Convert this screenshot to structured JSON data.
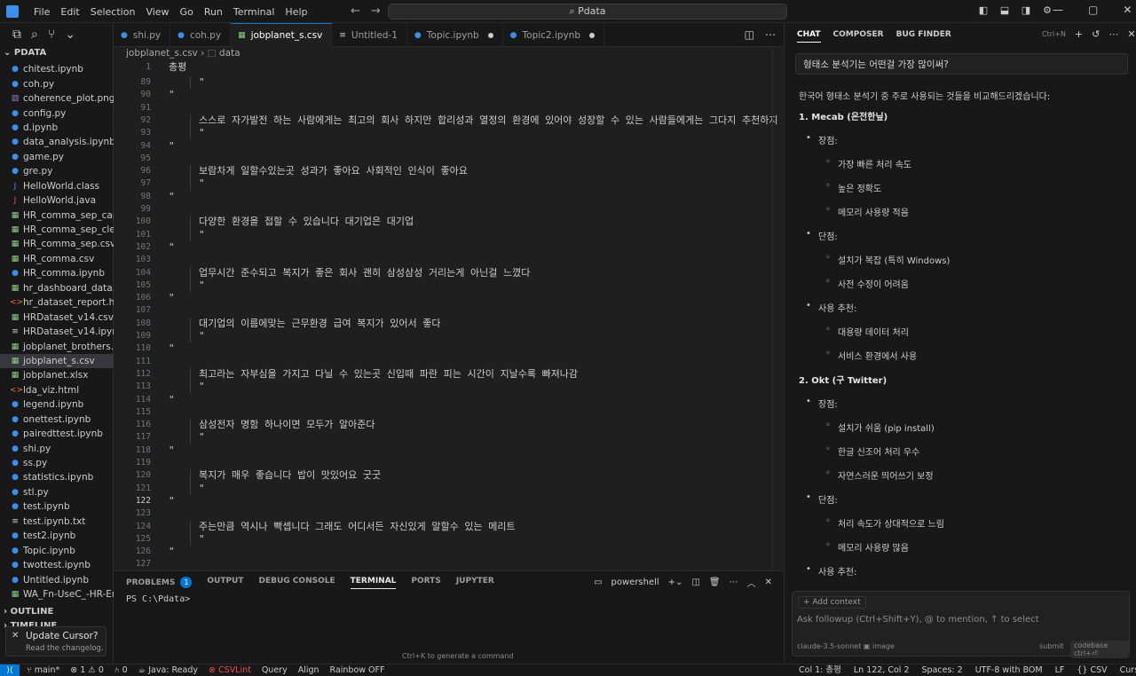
{
  "titlebar": {
    "menu": [
      "File",
      "Edit",
      "Selection",
      "View",
      "Go",
      "Run",
      "Terminal",
      "Help"
    ],
    "search": "Pdata"
  },
  "explorer": {
    "root": "PDATA",
    "files": [
      {
        "name": "chitest.ipynb",
        "type": "nb"
      },
      {
        "name": "coh.py",
        "type": "py"
      },
      {
        "name": "coherence_plot.png",
        "type": "img"
      },
      {
        "name": "config.py",
        "type": "py"
      },
      {
        "name": "d.ipynb",
        "type": "nb"
      },
      {
        "name": "data_analysis.ipynb",
        "type": "nb"
      },
      {
        "name": "game.py",
        "type": "py"
      },
      {
        "name": "gre.py",
        "type": "py"
      },
      {
        "name": "HelloWorld.class",
        "type": "class"
      },
      {
        "name": "HelloWorld.java",
        "type": "java"
      },
      {
        "name": "HR_comma_sep_capp...",
        "type": "csv"
      },
      {
        "name": "HR_comma_sep_clean...",
        "type": "csv"
      },
      {
        "name": "HR_comma_sep.csv",
        "type": "csv"
      },
      {
        "name": "HR_comma.csv",
        "type": "csv"
      },
      {
        "name": "HR_comma.ipynb",
        "type": "nb"
      },
      {
        "name": "hr_dashboard_data.csv",
        "type": "csv"
      },
      {
        "name": "hr_dataset_report.html",
        "type": "html"
      },
      {
        "name": "HRDataset_v14.csv",
        "type": "csv"
      },
      {
        "name": "HRDataset_v14.ipynb....",
        "type": "txt"
      },
      {
        "name": "jobplanet_brothers.xlsx",
        "type": "xlsx"
      },
      {
        "name": "jobplanet_s.csv",
        "type": "csv",
        "active": true
      },
      {
        "name": "jobplanet.xlsx",
        "type": "xlsx"
      },
      {
        "name": "lda_viz.html",
        "type": "html"
      },
      {
        "name": "legend.ipynb",
        "type": "nb"
      },
      {
        "name": "onettest.ipynb",
        "type": "nb"
      },
      {
        "name": "pairedttest.ipynb",
        "type": "nb"
      },
      {
        "name": "shi.py",
        "type": "py"
      },
      {
        "name": "ss.py",
        "type": "py"
      },
      {
        "name": "statistics.ipynb",
        "type": "nb"
      },
      {
        "name": "stl.py",
        "type": "py"
      },
      {
        "name": "test.ipynb",
        "type": "nb"
      },
      {
        "name": "test.ipynb.txt",
        "type": "txt"
      },
      {
        "name": "test2.ipynb",
        "type": "nb"
      },
      {
        "name": "Topic.ipynb",
        "type": "nb"
      },
      {
        "name": "twottest.ipynb",
        "type": "nb"
      },
      {
        "name": "Untitled.ipynb",
        "type": "nb"
      },
      {
        "name": "WA_Fn-UseC_-HR-Em...",
        "type": "xlsx"
      }
    ],
    "outline": "OUTLINE",
    "timeline": "TIMELINE"
  },
  "toast": {
    "title": "Update Cursor?",
    "sub": "Read the changelog."
  },
  "tabs": [
    {
      "label": "shi.py",
      "icon": "python-icon"
    },
    {
      "label": "coh.py",
      "icon": "python-icon"
    },
    {
      "label": "jobplanet_s.csv",
      "icon": "csv-icon",
      "active": true
    },
    {
      "label": "Untitled-1",
      "icon": "file-icon"
    },
    {
      "label": "Topic.ipynb",
      "icon": "notebook-icon",
      "dirty": true
    },
    {
      "label": "Topic2.ipynb",
      "icon": "notebook-icon",
      "dirty": true
    }
  ],
  "breadcrumb": {
    "file": "jobplanet_s.csv",
    "symbol": "data"
  },
  "editor": {
    "sticky": {
      "num": "1",
      "text": "총평"
    },
    "lines": [
      {
        "num": "89",
        "text": "\"",
        "indent": true
      },
      {
        "num": "90",
        "text": "\""
      },
      {
        "num": "91",
        "text": ""
      },
      {
        "num": "92",
        "text": "스스로 자가발전 하는 사람에게는 최고의 회사 하지만 합리성과 열정의 환경에 있어야 성장할 수 있는 사람들에게는 그다지 추천하지",
        "indent": true
      },
      {
        "num": "93",
        "text": "\"",
        "indent": true
      },
      {
        "num": "94",
        "text": "\""
      },
      {
        "num": "95",
        "text": ""
      },
      {
        "num": "96",
        "text": "보람차게 일할수있는곳 성과가 좋아요 사회적인 인식이 좋아요",
        "indent": true
      },
      {
        "num": "97",
        "text": "\"",
        "indent": true
      },
      {
        "num": "98",
        "text": "\""
      },
      {
        "num": "99",
        "text": ""
      },
      {
        "num": "100",
        "text": "다양한 환경을 접할 수 있습니다 대기업은 대기업",
        "indent": true
      },
      {
        "num": "101",
        "text": "\"",
        "indent": true
      },
      {
        "num": "102",
        "text": "\""
      },
      {
        "num": "103",
        "text": ""
      },
      {
        "num": "104",
        "text": "업무시간 준수되고 복지가 좋은 회사 괜히 삼성삼성 거리는게 아닌걸 느꼈다",
        "indent": true
      },
      {
        "num": "105",
        "text": "\"",
        "indent": true
      },
      {
        "num": "106",
        "text": "\""
      },
      {
        "num": "107",
        "text": ""
      },
      {
        "num": "108",
        "text": "대기업의 이름에맞는 근무환경 급여 복지가 있어서 좋다",
        "indent": true
      },
      {
        "num": "109",
        "text": "\"",
        "indent": true
      },
      {
        "num": "110",
        "text": "\""
      },
      {
        "num": "111",
        "text": ""
      },
      {
        "num": "112",
        "text": "최고라는 자부심을 가지고 다닐 수 있는곳 신입때 파란 피는 시간이 지날수록 빠져나감",
        "indent": true
      },
      {
        "num": "113",
        "text": "\"",
        "indent": true
      },
      {
        "num": "114",
        "text": "\""
      },
      {
        "num": "115",
        "text": ""
      },
      {
        "num": "116",
        "text": "삼성전자 명함 하나이면 모두가 알아준다",
        "indent": true
      },
      {
        "num": "117",
        "text": "\"",
        "indent": true
      },
      {
        "num": "118",
        "text": "\""
      },
      {
        "num": "119",
        "text": ""
      },
      {
        "num": "120",
        "text": "복지가 매우 좋습니다 밥이 맛있어요 굿굿",
        "indent": true
      },
      {
        "num": "121",
        "text": "\"",
        "indent": true
      },
      {
        "num": "122",
        "text": "\"",
        "current": true
      },
      {
        "num": "123",
        "text": ""
      },
      {
        "num": "124",
        "text": "주는만큼 역시나 빡셉니다 그래도 어디서든 자신있게 말할수 있는 메리트",
        "indent": true
      },
      {
        "num": "125",
        "text": "\"",
        "indent": true
      },
      {
        "num": "126",
        "text": "\""
      },
      {
        "num": "127",
        "text": ""
      }
    ]
  },
  "panel": {
    "tabs": [
      "PROBLEMS",
      "OUTPUT",
      "DEBUG CONSOLE",
      "TERMINAL",
      "PORTS",
      "JUPYTER"
    ],
    "problems_count": "1",
    "shell": "powershell",
    "prompt": "PS C:\\Pdata>",
    "hint": "Ctrl+K to generate a command"
  },
  "chat": {
    "tabs": [
      "CHAT",
      "COMPOSER",
      "BUG FINDER"
    ],
    "shortcut": "Ctrl+N",
    "question": "형태소 분석기는 어떤걸 가장 많이써?",
    "intro": "한국어 형태소 분석기 중 주로 사용되는 것들을 비교해드리겠습니다:",
    "items": [
      {
        "level": 0,
        "text": "1. Mecab (은전한닢)"
      },
      {
        "level": 1,
        "text": "장점:"
      },
      {
        "level": 2,
        "text": "가장 빠른 처리 속도"
      },
      {
        "level": 2,
        "text": "높은 정확도"
      },
      {
        "level": 2,
        "text": "메모리 사용량 적음"
      },
      {
        "level": 1,
        "text": "단점:"
      },
      {
        "level": 2,
        "text": "설치가 복잡 (특히 Windows)"
      },
      {
        "level": 2,
        "text": "사전 수정이 어려움"
      },
      {
        "level": 1,
        "text": "사용 추천:"
      },
      {
        "level": 2,
        "text": "대용량 데이터 처리"
      },
      {
        "level": 2,
        "text": "서비스 환경에서 사용"
      },
      {
        "level": 0,
        "text": "2. Okt (구 Twitter)"
      },
      {
        "level": 1,
        "text": "장점:"
      },
      {
        "level": 2,
        "text": "설치가 쉬움 (pip install)"
      },
      {
        "level": 2,
        "text": "한글 신조어 처리 우수"
      },
      {
        "level": 2,
        "text": "자연스러운 띄어쓰기 보정"
      },
      {
        "level": 1,
        "text": "단점:"
      },
      {
        "level": 2,
        "text": "처리 속도가 상대적으로 느림"
      },
      {
        "level": 2,
        "text": "메모리 사용량 많음"
      },
      {
        "level": 1,
        "text": "사용 추천:"
      }
    ],
    "add_context": "+ Add context",
    "followup_placeholder": "Ask followup (Ctrl+Shift+Y), @ to mention, ↑ to select",
    "model": "claude-3.5-sonnet",
    "image": "image",
    "submit": "submit",
    "codebase": "codebase ctrl+⏎"
  },
  "statusbar": {
    "branch": "main*",
    "errors": "1",
    "warnings": "0",
    "ports": "0",
    "java": "Java: Ready",
    "csvlint": "CSVLint",
    "query": "Query",
    "align": "Align",
    "rainbow": "Rainbow OFF",
    "col": "Col 1: 총평",
    "position": "Ln 122, Col 2",
    "spaces": "Spaces: 2",
    "encoding": "UTF-8 with BOM",
    "eol": "LF",
    "lang": "CSV",
    "tab": "Cursor Tab"
  }
}
